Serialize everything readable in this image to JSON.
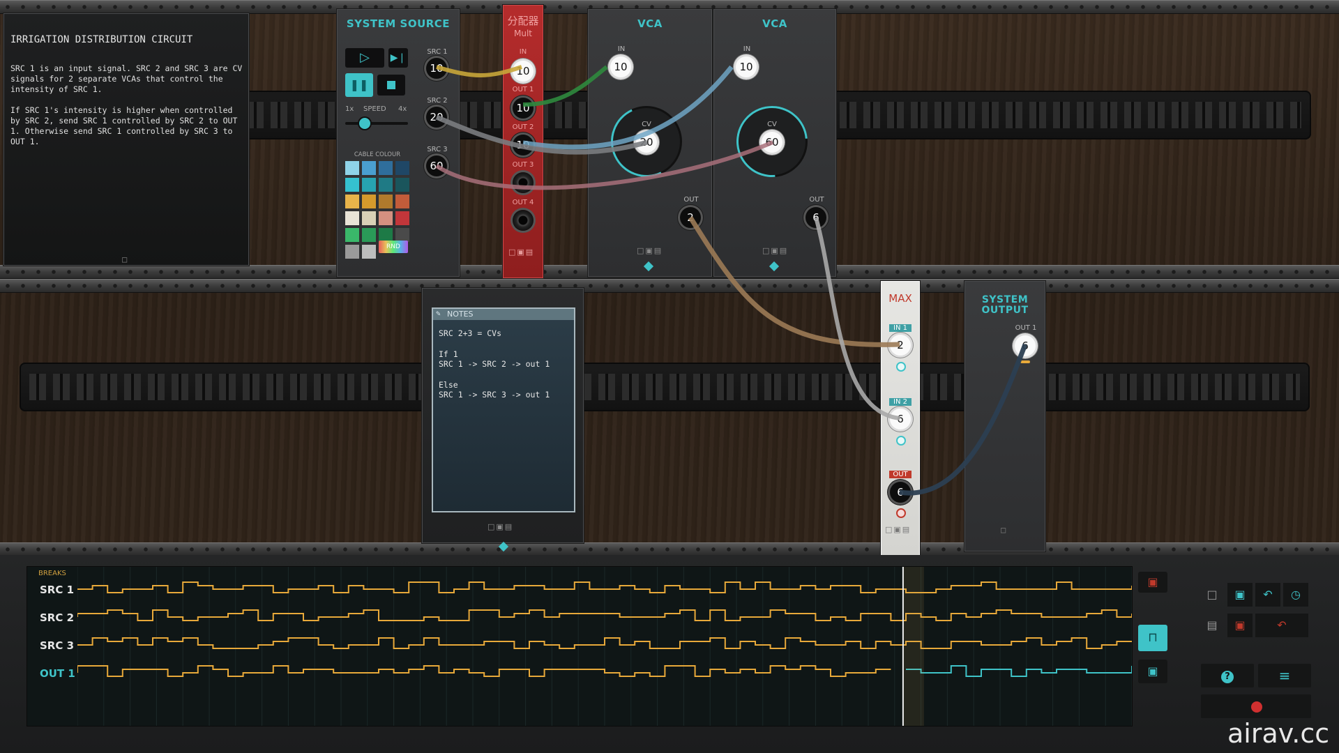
{
  "puzzle": {
    "title": "IRRIGATION DISTRIBUTION CIRCUIT",
    "description_1": "SRC 1 is an input signal. SRC 2 and SRC 3 are CV signals for 2 separate VCAs that control the intensity of SRC 1.",
    "description_2": "If SRC 1's intensity is higher when controlled by SRC 2, send SRC 1 controlled by SRC 2 to OUT 1. Otherwise send SRC 1 controlled by SRC 3 to OUT 1."
  },
  "system_source": {
    "title": "SYSTEM SOURCE",
    "speed_min": "1x",
    "speed_label": "SPEED",
    "speed_max": "4x",
    "cable_colour_label": "CABLE COLOUR",
    "rnd_label": "RND",
    "sources": [
      {
        "label": "SRC 1",
        "value": "10"
      },
      {
        "label": "SRC 2",
        "value": "20"
      },
      {
        "label": "SRC 3",
        "value": "60"
      }
    ],
    "swatches": [
      "#8fd3e8",
      "#4a9fd0",
      "#2f6e9c",
      "#1f4766",
      "#35c1cf",
      "#27a3b0",
      "#1f7a85",
      "#1a555c",
      "#e8b44a",
      "#d69a2c",
      "#b07a2c",
      "#c25c3a",
      "#e8e3d6",
      "#d9d0b6",
      "#d49080",
      "#c2363a",
      "#3ab86a",
      "#2a9a58",
      "#1d7a46",
      "#4a4a4a",
      "#9a9a9a",
      "#bdbdbd"
    ]
  },
  "mult": {
    "title_cn": "分配器",
    "title": "Mult",
    "in_label": "IN",
    "in_value": "10",
    "outs": [
      {
        "label": "OUT 1",
        "value": "10"
      },
      {
        "label": "OUT 2",
        "value": "10"
      },
      {
        "label": "OUT 3",
        "value": ""
      },
      {
        "label": "OUT 4",
        "value": ""
      }
    ]
  },
  "vca1": {
    "title": "VCA",
    "in_label": "IN",
    "in_value": "10",
    "cv_label": "CV",
    "cv_value": "20",
    "out_label": "OUT",
    "out_value": "2"
  },
  "vca2": {
    "title": "VCA",
    "in_label": "IN",
    "in_value": "10",
    "cv_label": "CV",
    "cv_value": "60",
    "out_label": "OUT",
    "out_value": "6"
  },
  "notes": {
    "header": "NOTES",
    "line1": "SRC 2+3 = CVs",
    "line2": "If 1",
    "line3": "SRC 1 -> SRC 2 -> out 1",
    "line4": "Else",
    "line5": "SRC 1 -> SRC 3 -> out 1"
  },
  "max": {
    "title": "MAX",
    "in1_label": "IN 1",
    "in1_value": "2",
    "in2_label": "IN 2",
    "in2_value": "6",
    "out_label": "OUT",
    "out_value": "6"
  },
  "system_output": {
    "title_1": "SYSTEM",
    "title_2": "OUTPUT",
    "out_label": "OUT 1",
    "out_value": "6"
  },
  "scope": {
    "breaks_label": "BREAKS",
    "channels": [
      {
        "label": "SRC 1",
        "color": "#e8a93a"
      },
      {
        "label": "SRC 2",
        "color": "#e8a93a"
      },
      {
        "label": "SRC 3",
        "color": "#e8a93a"
      },
      {
        "label": "OUT 1",
        "color": "#3fc3c8"
      }
    ],
    "playhead_fraction": 0.783
  },
  "watermark": "airav.cc",
  "colors": {
    "accent": "#3fc3c8",
    "signal": "#e8a93a",
    "mult_red": "#b52c2c"
  }
}
